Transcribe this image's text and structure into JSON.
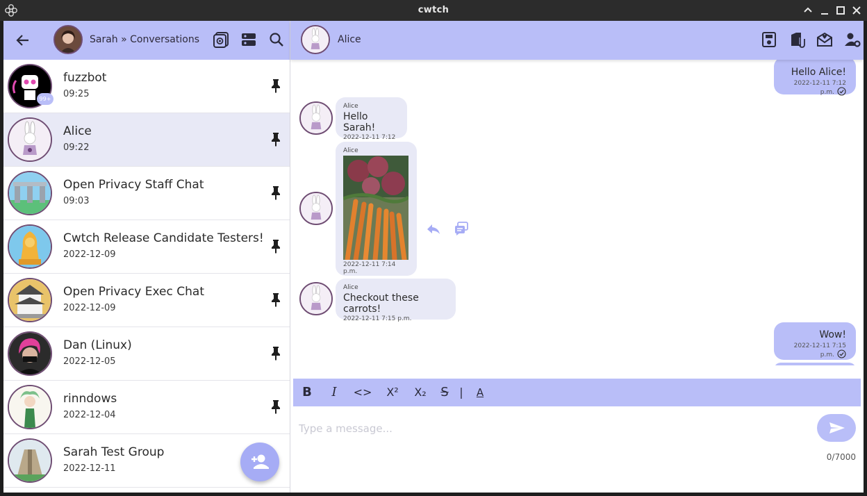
{
  "window": {
    "title": "cwtch",
    "controls": [
      "chevron-up-icon",
      "minimize-icon",
      "maximize-icon",
      "close-icon"
    ]
  },
  "left_header": {
    "profile_title": "Sarah » Conversations",
    "icons": [
      "back-arrow-icon",
      "tor-status-icon",
      "server-icon",
      "search-icon"
    ]
  },
  "conversations": [
    {
      "name": "fuzzbot",
      "time": "09:25",
      "badge": "99+",
      "pinned": true
    },
    {
      "name": "Alice",
      "time": "09:22",
      "pinned": true,
      "selected": true
    },
    {
      "name": "Open Privacy Staff Chat",
      "time": "09:03",
      "pinned": true
    },
    {
      "name": "Cwtch Release Candidate Testers!",
      "time": "2022-12-09",
      "pinned": true
    },
    {
      "name": "Open Privacy Exec Chat",
      "time": "2022-12-09",
      "pinned": true
    },
    {
      "name": "Dan (Linux)",
      "time": "2022-12-05",
      "pinned": true
    },
    {
      "name": "rinndows",
      "time": "2022-12-04",
      "pinned": true
    },
    {
      "name": "Sarah Test Group",
      "time": "2022-12-11",
      "pinned": false
    }
  ],
  "chat_header": {
    "contact_name": "Alice",
    "icons": [
      "shared-files-icon",
      "attach-file-icon",
      "invite-icon",
      "contact-settings-icon"
    ]
  },
  "messages": [
    {
      "direction": "out",
      "text": "Hello Alice!",
      "stamp": "2022-12-11 7:12 p.m.",
      "acknowledged": true
    },
    {
      "direction": "in",
      "sender": "Alice",
      "text": "Hello Sarah!",
      "stamp": "2022-12-11 7:12 p.m."
    },
    {
      "direction": "in",
      "sender": "Alice",
      "type": "image",
      "image_desc": "photo of carrots and potatoes",
      "stamp": "2022-12-11 7:14 p.m."
    },
    {
      "direction": "in",
      "sender": "Alice",
      "text": "Checkout these carrots!",
      "stamp": "2022-12-11 7:15 p.m."
    },
    {
      "direction": "out",
      "text": "Wow!",
      "stamp": "2022-12-11 7:15 p.m.",
      "acknowledged": true
    }
  ],
  "formatting_toolbar": {
    "bold": "B",
    "italic": "I",
    "code": "<>",
    "superscript": "X²",
    "subscript": "X₂",
    "strikethrough": "S",
    "separator": "|",
    "clear": "A"
  },
  "composer": {
    "placeholder": "Type a message...",
    "counter": "0/7000"
  },
  "colors": {
    "accent": "#b9bef8",
    "bubble_in": "#e8e9f6",
    "avatar_border": "#6f4d73"
  }
}
